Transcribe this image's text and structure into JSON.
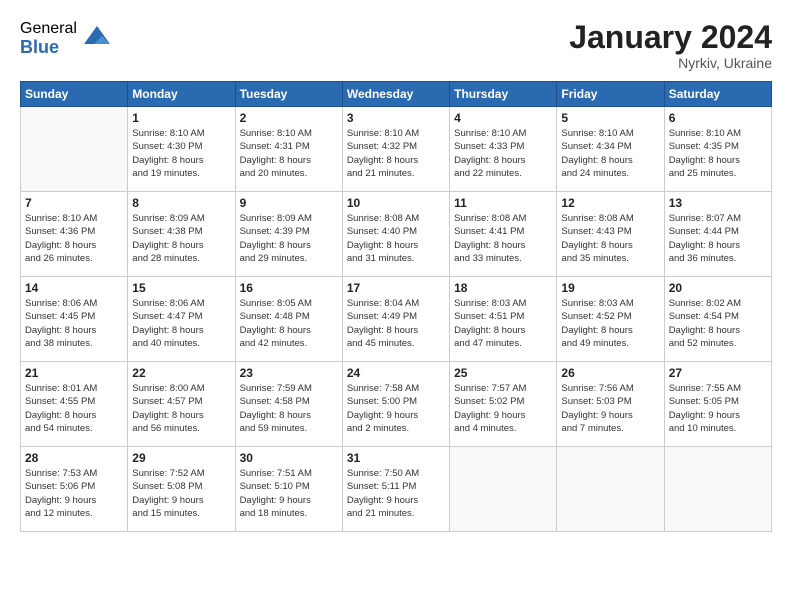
{
  "header": {
    "logo_general": "General",
    "logo_blue": "Blue",
    "month_title": "January 2024",
    "location": "Nyrkiv, Ukraine"
  },
  "weekdays": [
    "Sunday",
    "Monday",
    "Tuesday",
    "Wednesday",
    "Thursday",
    "Friday",
    "Saturday"
  ],
  "weeks": [
    [
      {
        "day": "",
        "info": ""
      },
      {
        "day": "1",
        "info": "Sunrise: 8:10 AM\nSunset: 4:30 PM\nDaylight: 8 hours\nand 19 minutes."
      },
      {
        "day": "2",
        "info": "Sunrise: 8:10 AM\nSunset: 4:31 PM\nDaylight: 8 hours\nand 20 minutes."
      },
      {
        "day": "3",
        "info": "Sunrise: 8:10 AM\nSunset: 4:32 PM\nDaylight: 8 hours\nand 21 minutes."
      },
      {
        "day": "4",
        "info": "Sunrise: 8:10 AM\nSunset: 4:33 PM\nDaylight: 8 hours\nand 22 minutes."
      },
      {
        "day": "5",
        "info": "Sunrise: 8:10 AM\nSunset: 4:34 PM\nDaylight: 8 hours\nand 24 minutes."
      },
      {
        "day": "6",
        "info": "Sunrise: 8:10 AM\nSunset: 4:35 PM\nDaylight: 8 hours\nand 25 minutes."
      }
    ],
    [
      {
        "day": "7",
        "info": "Sunrise: 8:10 AM\nSunset: 4:36 PM\nDaylight: 8 hours\nand 26 minutes."
      },
      {
        "day": "8",
        "info": "Sunrise: 8:09 AM\nSunset: 4:38 PM\nDaylight: 8 hours\nand 28 minutes."
      },
      {
        "day": "9",
        "info": "Sunrise: 8:09 AM\nSunset: 4:39 PM\nDaylight: 8 hours\nand 29 minutes."
      },
      {
        "day": "10",
        "info": "Sunrise: 8:08 AM\nSunset: 4:40 PM\nDaylight: 8 hours\nand 31 minutes."
      },
      {
        "day": "11",
        "info": "Sunrise: 8:08 AM\nSunset: 4:41 PM\nDaylight: 8 hours\nand 33 minutes."
      },
      {
        "day": "12",
        "info": "Sunrise: 8:08 AM\nSunset: 4:43 PM\nDaylight: 8 hours\nand 35 minutes."
      },
      {
        "day": "13",
        "info": "Sunrise: 8:07 AM\nSunset: 4:44 PM\nDaylight: 8 hours\nand 36 minutes."
      }
    ],
    [
      {
        "day": "14",
        "info": "Sunrise: 8:06 AM\nSunset: 4:45 PM\nDaylight: 8 hours\nand 38 minutes."
      },
      {
        "day": "15",
        "info": "Sunrise: 8:06 AM\nSunset: 4:47 PM\nDaylight: 8 hours\nand 40 minutes."
      },
      {
        "day": "16",
        "info": "Sunrise: 8:05 AM\nSunset: 4:48 PM\nDaylight: 8 hours\nand 42 minutes."
      },
      {
        "day": "17",
        "info": "Sunrise: 8:04 AM\nSunset: 4:49 PM\nDaylight: 8 hours\nand 45 minutes."
      },
      {
        "day": "18",
        "info": "Sunrise: 8:03 AM\nSunset: 4:51 PM\nDaylight: 8 hours\nand 47 minutes."
      },
      {
        "day": "19",
        "info": "Sunrise: 8:03 AM\nSunset: 4:52 PM\nDaylight: 8 hours\nand 49 minutes."
      },
      {
        "day": "20",
        "info": "Sunrise: 8:02 AM\nSunset: 4:54 PM\nDaylight: 8 hours\nand 52 minutes."
      }
    ],
    [
      {
        "day": "21",
        "info": "Sunrise: 8:01 AM\nSunset: 4:55 PM\nDaylight: 8 hours\nand 54 minutes."
      },
      {
        "day": "22",
        "info": "Sunrise: 8:00 AM\nSunset: 4:57 PM\nDaylight: 8 hours\nand 56 minutes."
      },
      {
        "day": "23",
        "info": "Sunrise: 7:59 AM\nSunset: 4:58 PM\nDaylight: 8 hours\nand 59 minutes."
      },
      {
        "day": "24",
        "info": "Sunrise: 7:58 AM\nSunset: 5:00 PM\nDaylight: 9 hours\nand 2 minutes."
      },
      {
        "day": "25",
        "info": "Sunrise: 7:57 AM\nSunset: 5:02 PM\nDaylight: 9 hours\nand 4 minutes."
      },
      {
        "day": "26",
        "info": "Sunrise: 7:56 AM\nSunset: 5:03 PM\nDaylight: 9 hours\nand 7 minutes."
      },
      {
        "day": "27",
        "info": "Sunrise: 7:55 AM\nSunset: 5:05 PM\nDaylight: 9 hours\nand 10 minutes."
      }
    ],
    [
      {
        "day": "28",
        "info": "Sunrise: 7:53 AM\nSunset: 5:06 PM\nDaylight: 9 hours\nand 12 minutes."
      },
      {
        "day": "29",
        "info": "Sunrise: 7:52 AM\nSunset: 5:08 PM\nDaylight: 9 hours\nand 15 minutes."
      },
      {
        "day": "30",
        "info": "Sunrise: 7:51 AM\nSunset: 5:10 PM\nDaylight: 9 hours\nand 18 minutes."
      },
      {
        "day": "31",
        "info": "Sunrise: 7:50 AM\nSunset: 5:11 PM\nDaylight: 9 hours\nand 21 minutes."
      },
      {
        "day": "",
        "info": ""
      },
      {
        "day": "",
        "info": ""
      },
      {
        "day": "",
        "info": ""
      }
    ]
  ]
}
